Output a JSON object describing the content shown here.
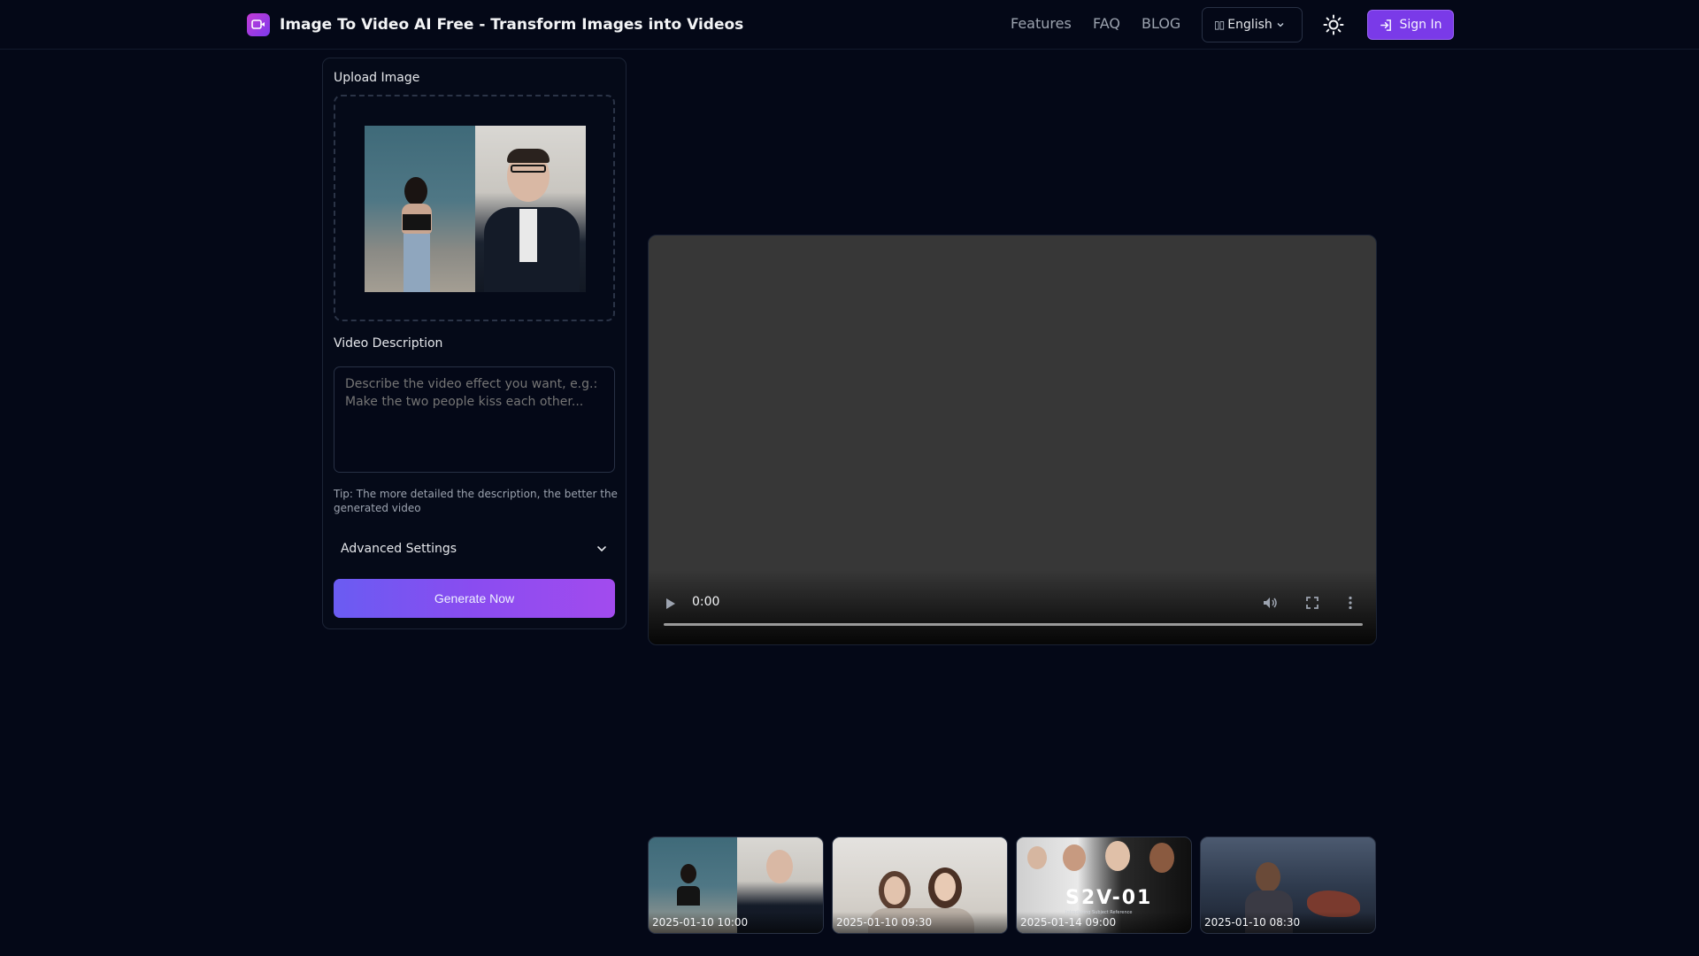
{
  "header": {
    "title": "Image To Video AI Free - Transform Images into Videos",
    "nav": {
      "features": "Features",
      "faq": "FAQ",
      "blog": "BLOG"
    },
    "language": "English",
    "sign_in": "Sign In"
  },
  "upload": {
    "label": "Upload Image"
  },
  "description": {
    "label": "Video Description",
    "placeholder": "Describe the video effect you want, e.g.: Make the two people kiss each other...",
    "value": "",
    "tip": "Tip: The more detailed the description, the better the generated video"
  },
  "advanced": {
    "label": "Advanced Settings"
  },
  "generate": {
    "label": "Generate Now"
  },
  "player": {
    "time": "0:00"
  },
  "gallery": [
    {
      "date": "2025-01-10 10:00"
    },
    {
      "date": "2025-01-10 09:30"
    },
    {
      "date": "2025-01-14 09:00",
      "overlay_title": "S2V-01",
      "overlay_subtitle": "Introducing Subject Reference"
    },
    {
      "date": "2025-01-10 08:30"
    }
  ],
  "colors": {
    "background": "#040817",
    "accent": "#7a3ae8",
    "generate_gradient_start": "#6a5cf2",
    "generate_gradient_end": "#a24bee"
  },
  "icons": {
    "logo": "image-to-video-logo-icon",
    "language": "flag-icon",
    "theme": "sun-icon",
    "sign_in": "login-arrow-icon",
    "advanced": "chevron-down-icon",
    "player": [
      "play-icon",
      "volume-icon",
      "fullscreen-icon",
      "more-vertical-icon"
    ]
  }
}
